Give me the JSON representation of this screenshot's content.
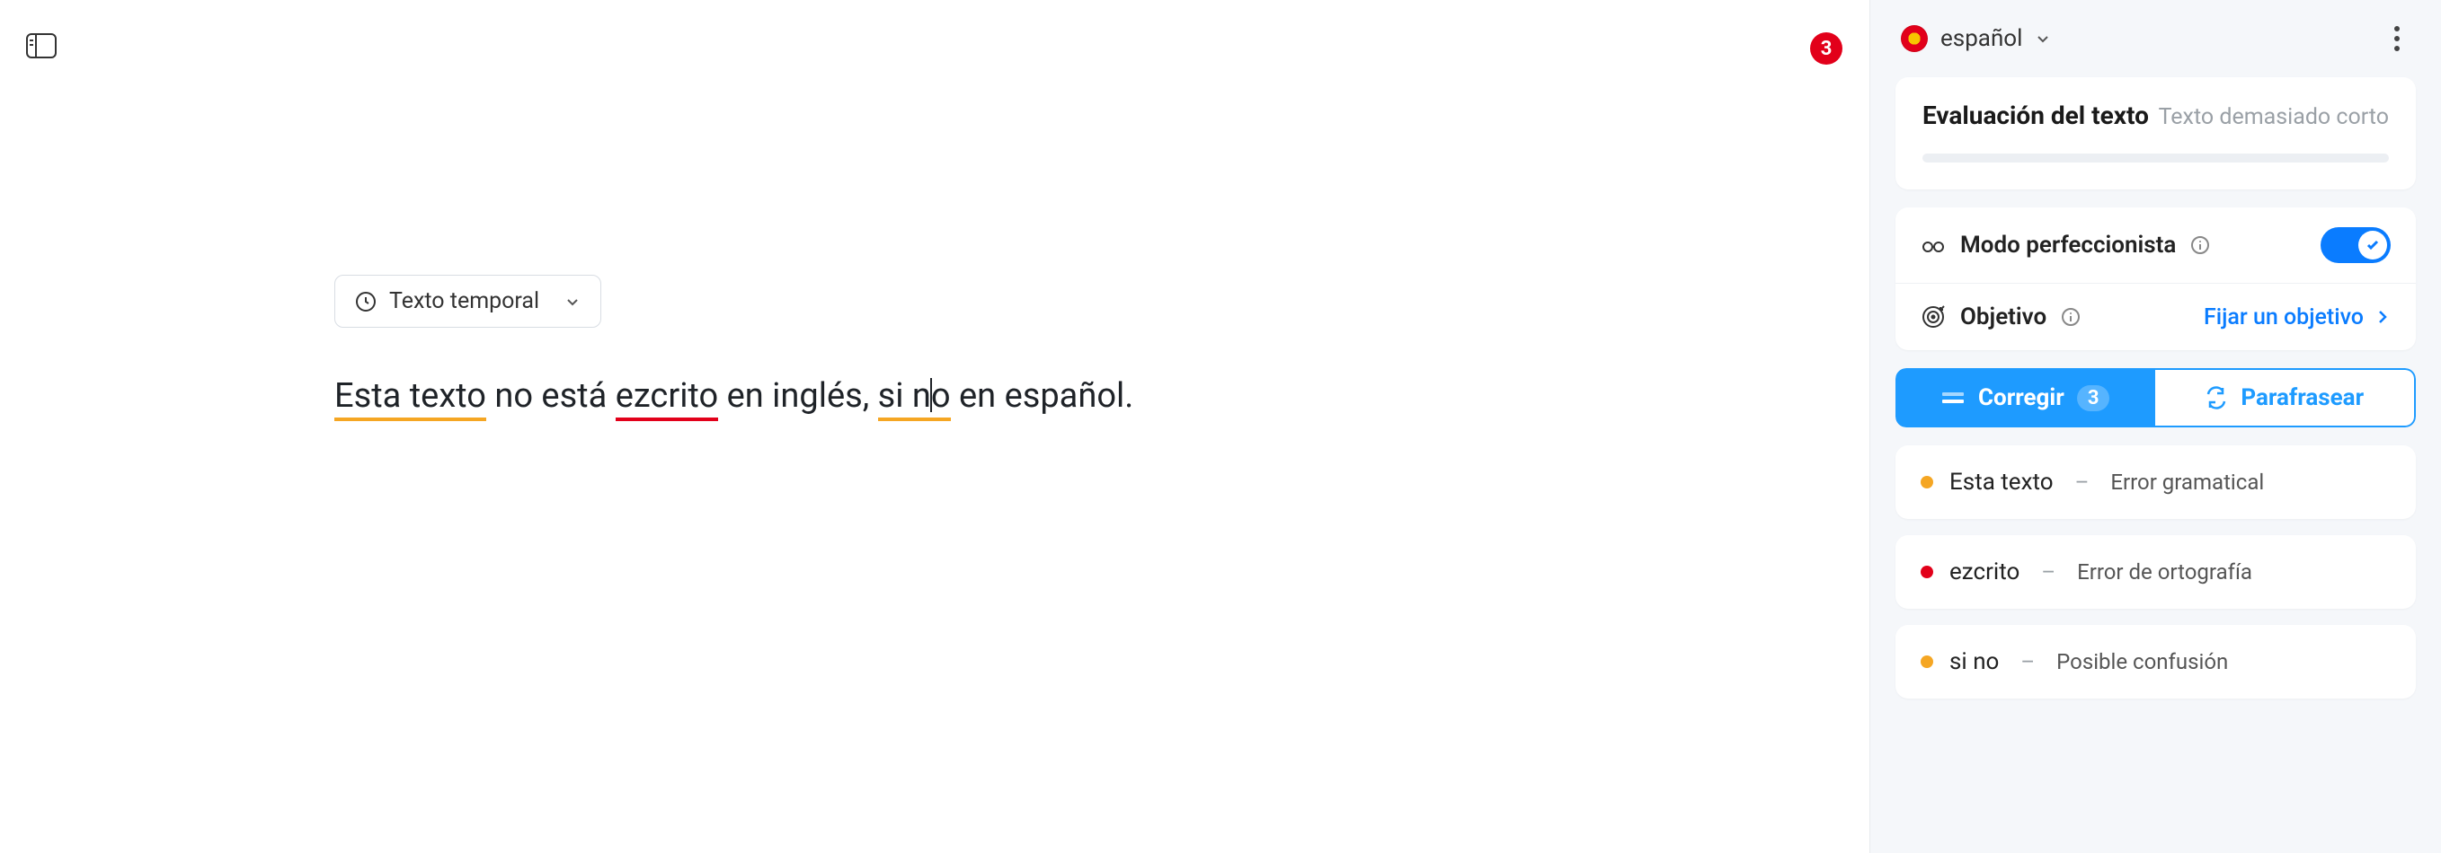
{
  "editor": {
    "badge_count": "3",
    "temp_label": "Texto temporal",
    "segments": {
      "s1": "Esta texto",
      "s2": " no está ",
      "s3": "ezcrito",
      "s4": " en inglés, ",
      "s5_a": "si n",
      "s5_b": "o",
      "s6": " en español."
    }
  },
  "sidebar": {
    "language": "español",
    "eval": {
      "title": "Evaluación del texto",
      "subtitle": "Texto demasiado corto"
    },
    "perfectionist": {
      "label": "Modo perfeccionista"
    },
    "objective": {
      "label": "Objetivo",
      "action": "Fijar un objetivo"
    },
    "tabs": {
      "correct": "Corregir",
      "correct_count": "3",
      "paraphrase": "Parafrasear"
    },
    "issues": [
      {
        "term": "Esta texto",
        "type": "Error gramatical",
        "dot": "orange"
      },
      {
        "term": "ezcrito",
        "type": "Error de ortografía",
        "dot": "red"
      },
      {
        "term": "si no",
        "type": "Posible confusión",
        "dot": "orange"
      }
    ]
  }
}
